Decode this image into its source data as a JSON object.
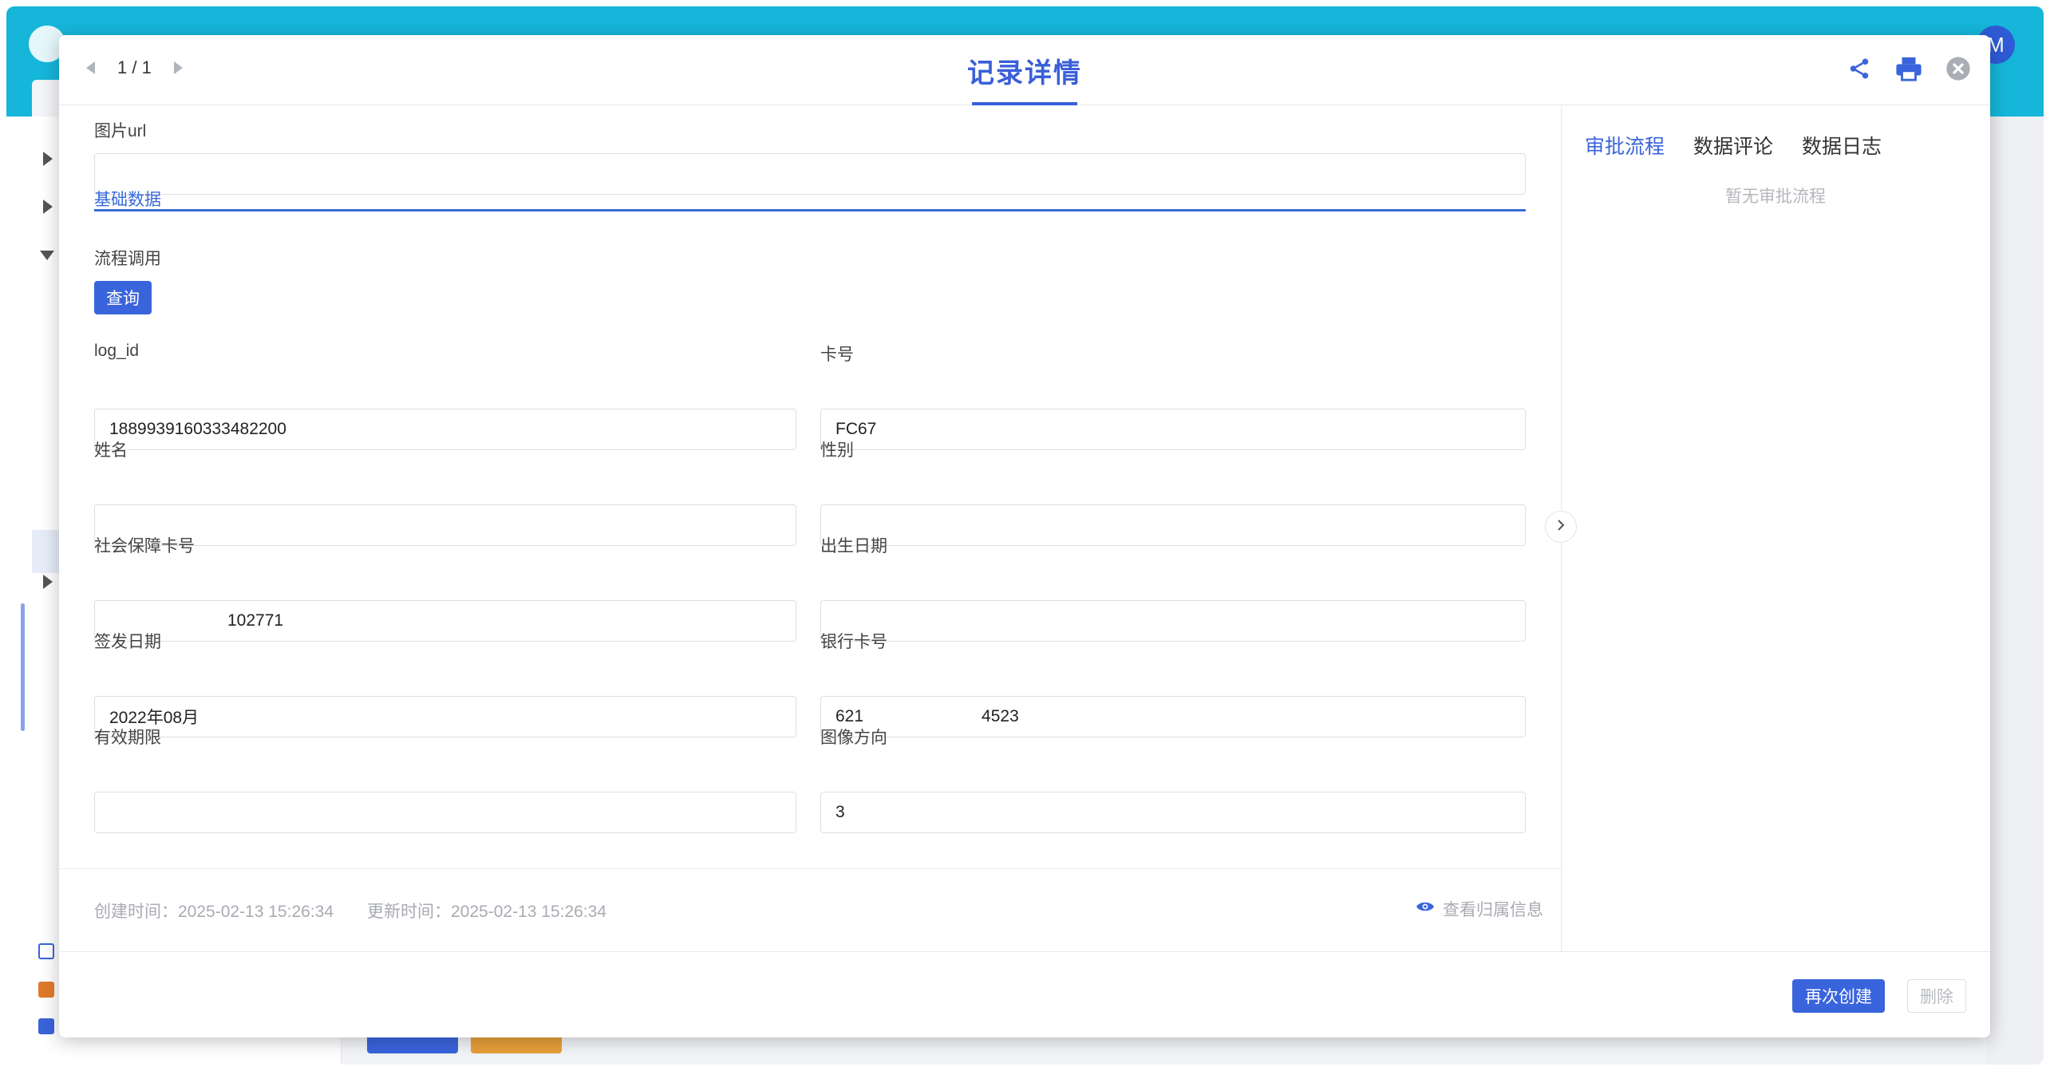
{
  "app": {
    "avatar_initial": "M"
  },
  "modal": {
    "title": "记录详情",
    "pager": "1 / 1"
  },
  "fields": {
    "image_url": {
      "label": "图片url",
      "value": ""
    },
    "section_title": "基础数据",
    "process_call": {
      "label": "流程调用",
      "button": "查询"
    },
    "log_id": {
      "label": "log_id",
      "value": "1889939160333482200"
    },
    "card_no": {
      "label": "卡号",
      "value": "FC67"
    },
    "name": {
      "label": "姓名",
      "value": ""
    },
    "gender": {
      "label": "性别",
      "value": ""
    },
    "social_card_no": {
      "label": "社会保障卡号",
      "value": "102771"
    },
    "birth_date": {
      "label": "出生日期",
      "value": ""
    },
    "issue_date": {
      "label": "签发日期",
      "value": "2022年08月"
    },
    "bank_card_no": {
      "label": "银行卡号",
      "value_prefix": "621",
      "value_suffix": "4523"
    },
    "valid_period": {
      "label": "有效期限",
      "value": ""
    },
    "image_orientation": {
      "label": "图像方向",
      "value": "3"
    }
  },
  "meta": {
    "created": "创建时间：2025-02-13 15:26:34",
    "updated": "更新时间：2025-02-13 15:26:34",
    "view_owner": "查看归属信息"
  },
  "side_panel": {
    "tabs": [
      "审批流程",
      "数据评论",
      "数据日志"
    ],
    "empty_text": "暂无审批流程"
  },
  "footer": {
    "recreate": "再次创建",
    "delete": "删除"
  },
  "colors": {
    "accent": "#3a64dc",
    "topbar": "#16b6da"
  }
}
